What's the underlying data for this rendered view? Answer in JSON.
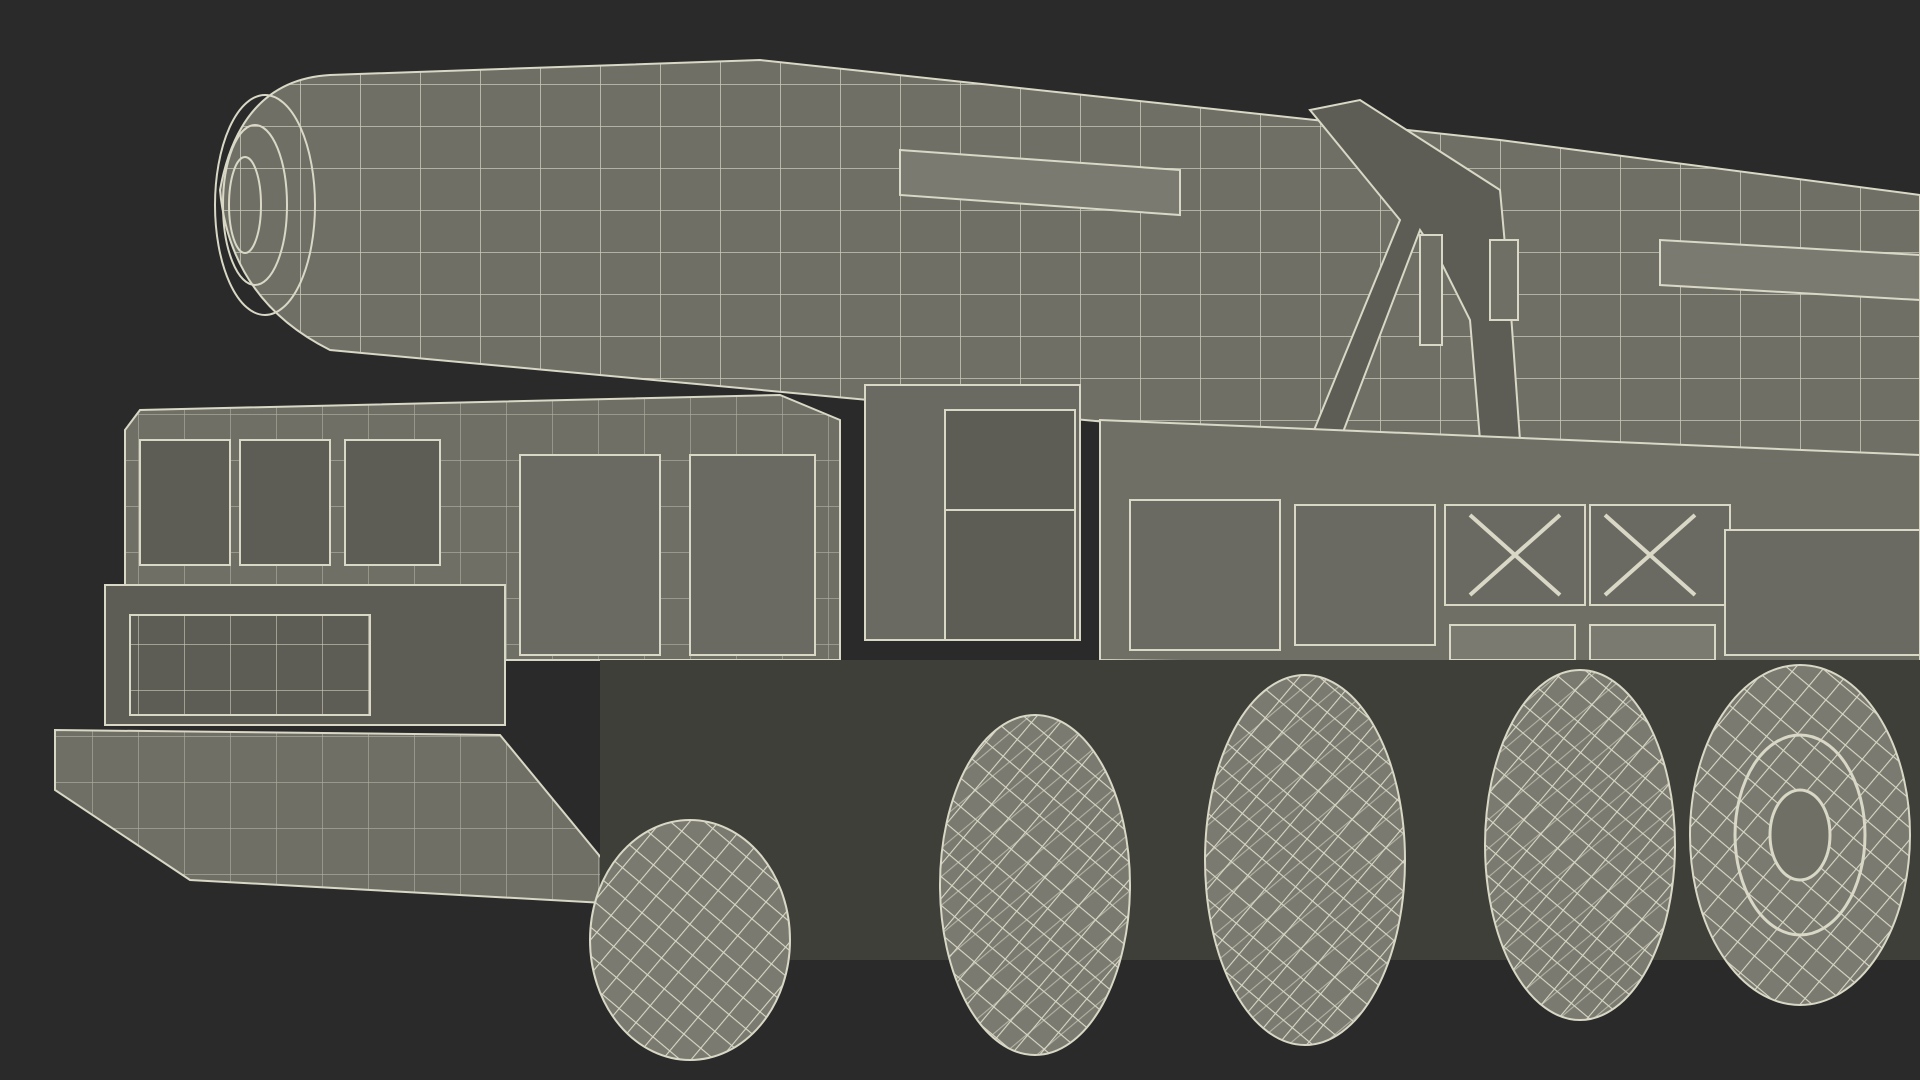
{
  "scene": {
    "subject": "mobile-missile-launcher-wireframe",
    "render_mode": "wireframe-over-shaded",
    "colors": {
      "background": "#2a2a2a",
      "surface": "#6f6f66",
      "surface_dark": "#5d5d55",
      "surface_light": "#7a7a70",
      "wire": "#d9d8c6",
      "shadow": "#3f3f39"
    },
    "parts": [
      "missile-body",
      "missile-nose",
      "erector-arm",
      "cab",
      "front-grille",
      "bumper",
      "equipment-box",
      "side-compartments",
      "wheels"
    ],
    "wheel_count_visible": 5
  }
}
